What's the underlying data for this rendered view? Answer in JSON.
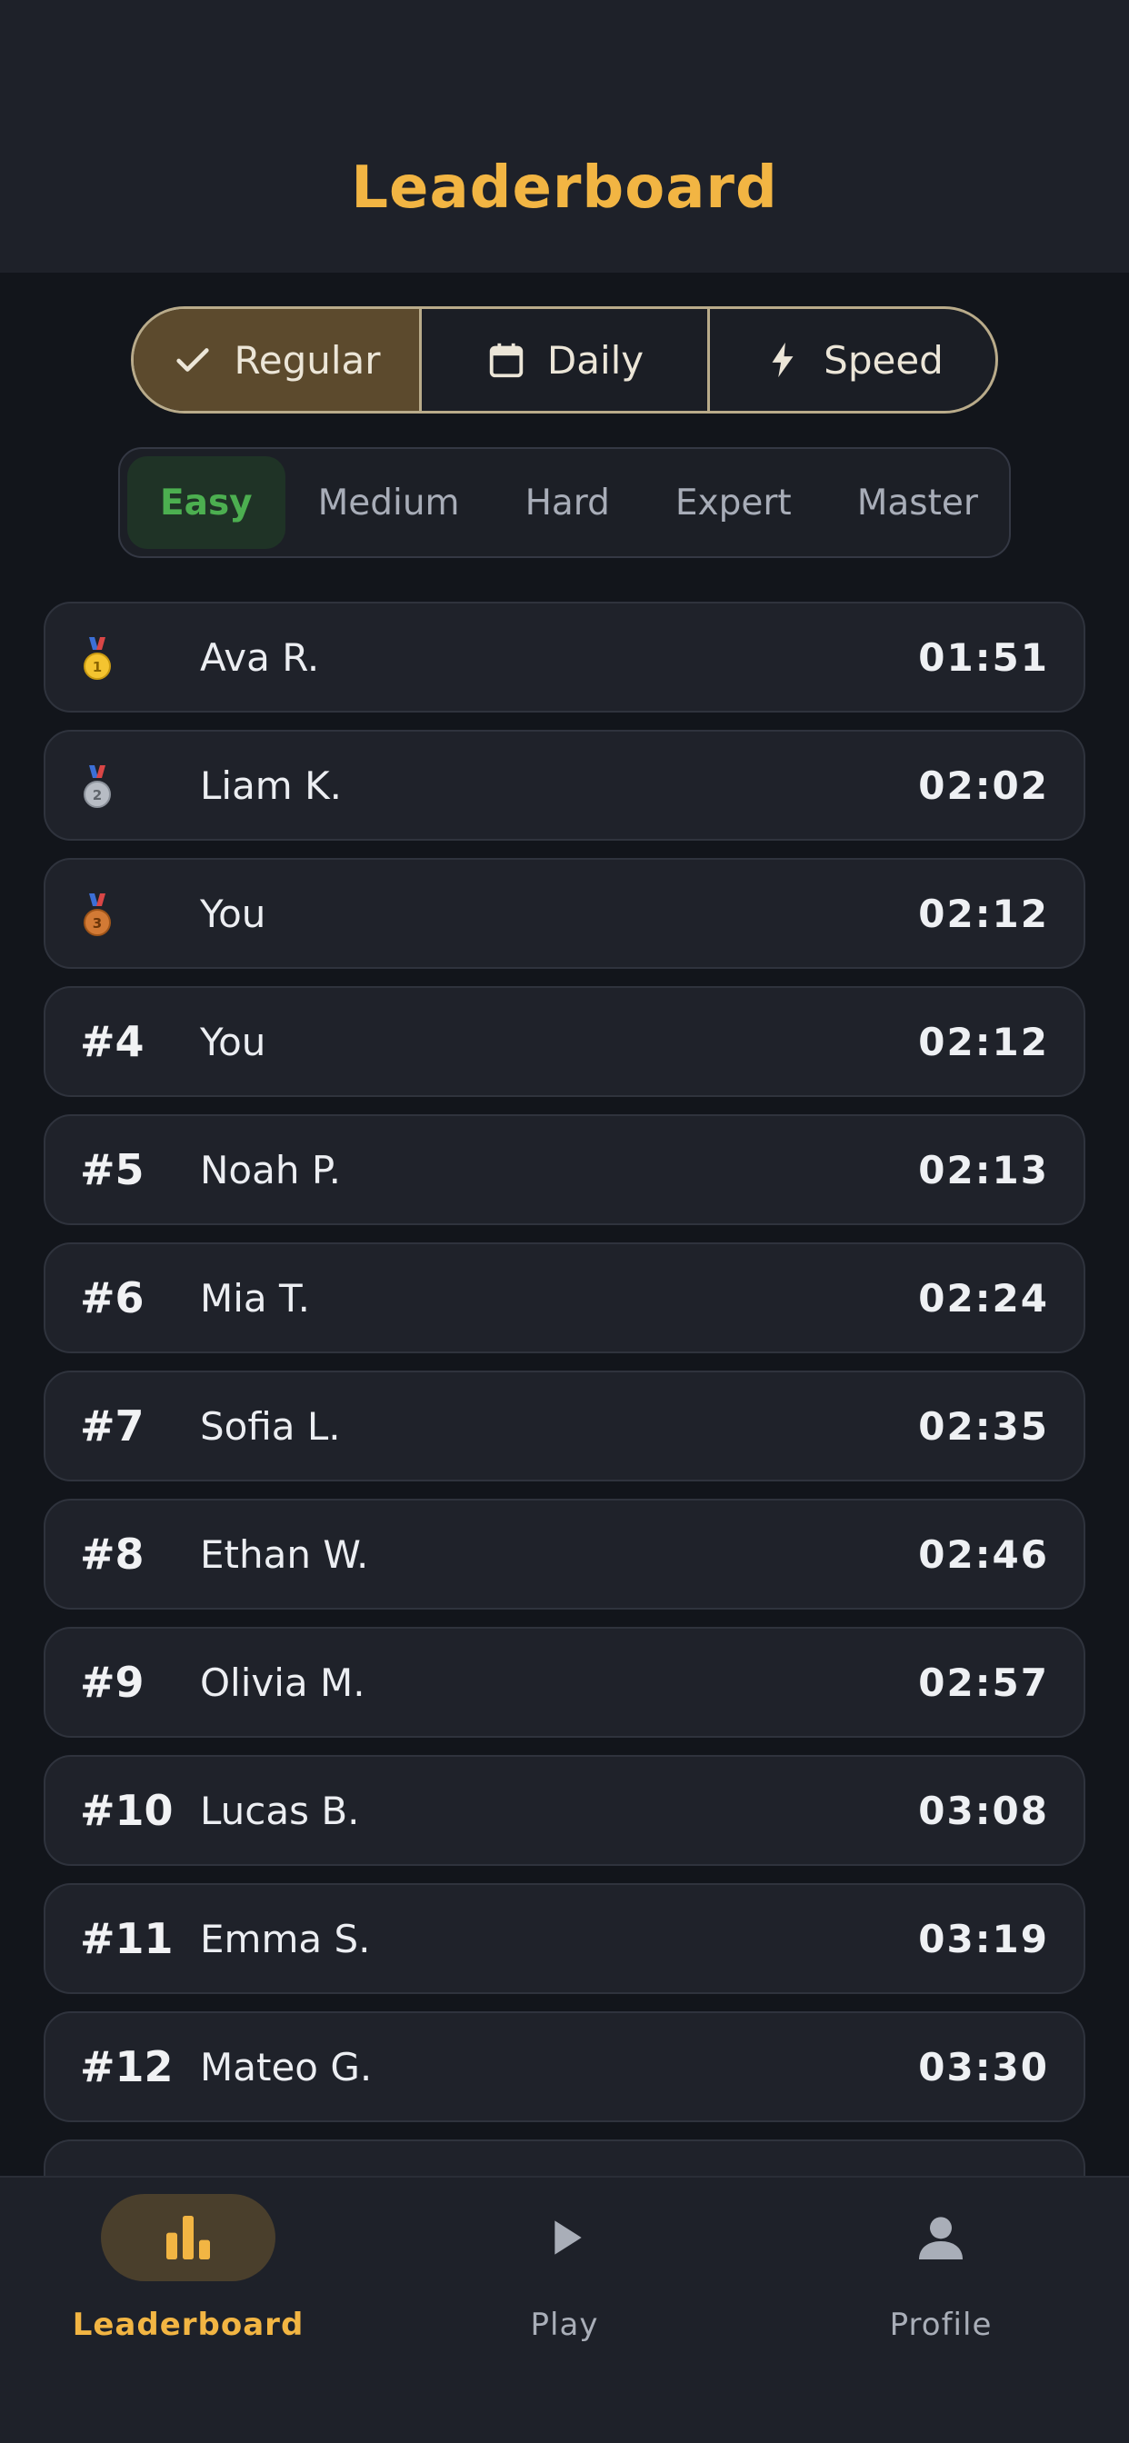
{
  "header": {
    "title": "Leaderboard"
  },
  "modes": [
    {
      "label": "Regular",
      "icon": "check-icon",
      "active": true
    },
    {
      "label": "Daily",
      "icon": "calendar-icon",
      "active": false
    },
    {
      "label": "Speed",
      "icon": "lightning-icon",
      "active": false
    }
  ],
  "difficulties": [
    {
      "label": "Easy",
      "active": true
    },
    {
      "label": "Medium",
      "active": false
    },
    {
      "label": "Hard",
      "active": false
    },
    {
      "label": "Expert",
      "active": false
    },
    {
      "label": "Master",
      "active": false
    }
  ],
  "rows": [
    {
      "rank": "",
      "medal": "gold-medal-icon",
      "name": "Ava R.",
      "time": "01:51"
    },
    {
      "rank": "",
      "medal": "silver-medal-icon",
      "name": "Liam K.",
      "time": "02:02"
    },
    {
      "rank": "",
      "medal": "bronze-medal-icon",
      "name": "You",
      "time": "02:12"
    },
    {
      "rank": "#4",
      "name": "You",
      "time": "02:12"
    },
    {
      "rank": "#5",
      "name": "Noah P.",
      "time": "02:13"
    },
    {
      "rank": "#6",
      "name": "Mia T.",
      "time": "02:24"
    },
    {
      "rank": "#7",
      "name": "Sofia L.",
      "time": "02:35"
    },
    {
      "rank": "#8",
      "name": "Ethan W.",
      "time": "02:46"
    },
    {
      "rank": "#9",
      "name": "Olivia M.",
      "time": "02:57"
    },
    {
      "rank": "#10",
      "name": "Lucas B.",
      "time": "03:08"
    },
    {
      "rank": "#11",
      "name": "Emma S.",
      "time": "03:19"
    },
    {
      "rank": "#12",
      "name": "Mateo G.",
      "time": "03:30"
    }
  ],
  "nav": [
    {
      "label": "Leaderboard",
      "icon": "bar-chart-icon",
      "active": true
    },
    {
      "label": "Play",
      "icon": "play-icon",
      "active": false
    },
    {
      "label": "Profile",
      "icon": "person-icon",
      "active": false
    }
  ],
  "colors": {
    "accent": "#f2b543",
    "easy_green": "#4caf50",
    "background": "#12151b",
    "card": "#1f222a"
  }
}
